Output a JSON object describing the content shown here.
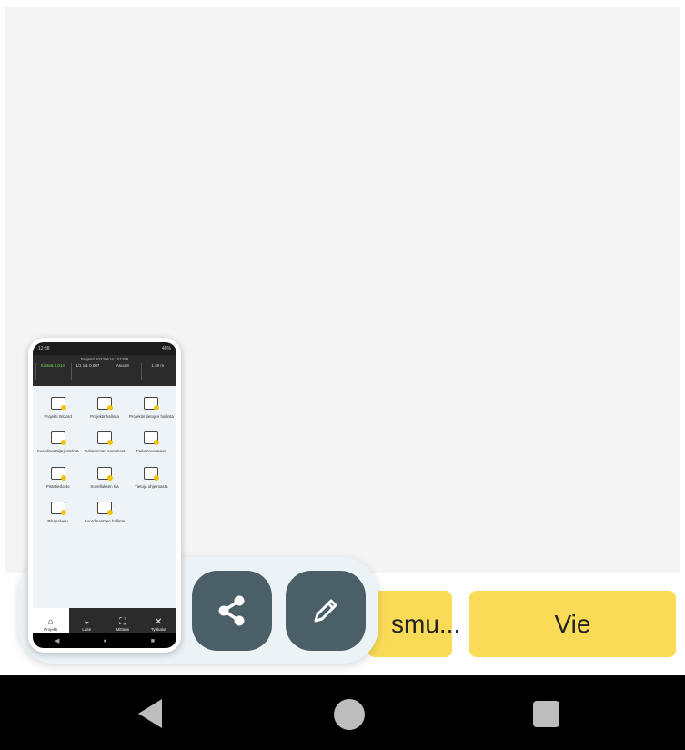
{
  "buttons": {
    "partial_label": "smu...",
    "vie_label": "Vie"
  },
  "screenshot_panel": {
    "share_icon": "share-icon",
    "edit_icon": "pencil-icon"
  },
  "colors": {
    "accent_yellow": "#fadb57",
    "panel_button": "#4a5f67",
    "panel_bg": "#ecf3f7"
  },
  "thumbnail": {
    "status_left": "12:38",
    "status_right": "46%",
    "header_title": "Projekti 20230616 101358",
    "cells": [
      "Kiinteä 0.014",
      "1/1 1/1 0.007",
      "Asuu 8",
      "1.35 m"
    ],
    "items": [
      "Projekti Wizard",
      "Projektinhallinta",
      "Projektin tietojen hallinta",
      "Koordinaattijärjestelmä",
      "Tukiaseman asetukset",
      "Paikannuskaava",
      "Pistetiedosto",
      "Sovelluksen tila",
      "Tietoja ohjelmasta",
      "Pilvipalvelu",
      "Koordinaattien hallinta"
    ],
    "tabs": [
      "Projekti",
      "Laite",
      "Mittaus",
      "Työkalut"
    ],
    "tab_glyphs": [
      "⌂",
      "◒",
      "⛶",
      "✕"
    ],
    "sysnav": [
      "◀",
      "●",
      "■"
    ]
  }
}
